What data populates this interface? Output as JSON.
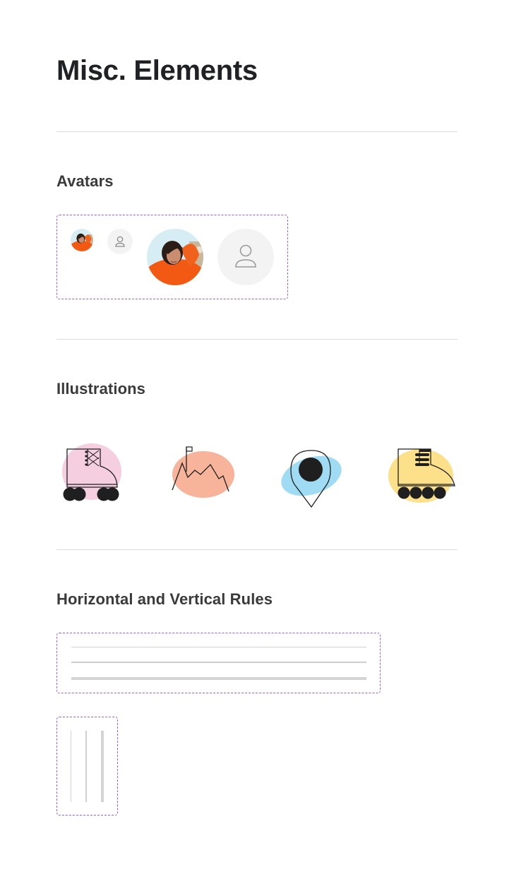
{
  "page": {
    "title": "Misc. Elements"
  },
  "sections": {
    "avatars": {
      "title": "Avatars"
    },
    "illustrations": {
      "title": "Illustrations"
    },
    "rules": {
      "title": "Horizontal and Vertical Rules"
    }
  },
  "colors": {
    "dashed_border": "#9b5de5",
    "avatar_placeholder_bg": "#f3f3f3",
    "illustration_pink": "#f5cfe0",
    "illustration_peach": "#f7b49b",
    "illustration_blue": "#9fdcf3",
    "illustration_yellow": "#fde08a"
  }
}
